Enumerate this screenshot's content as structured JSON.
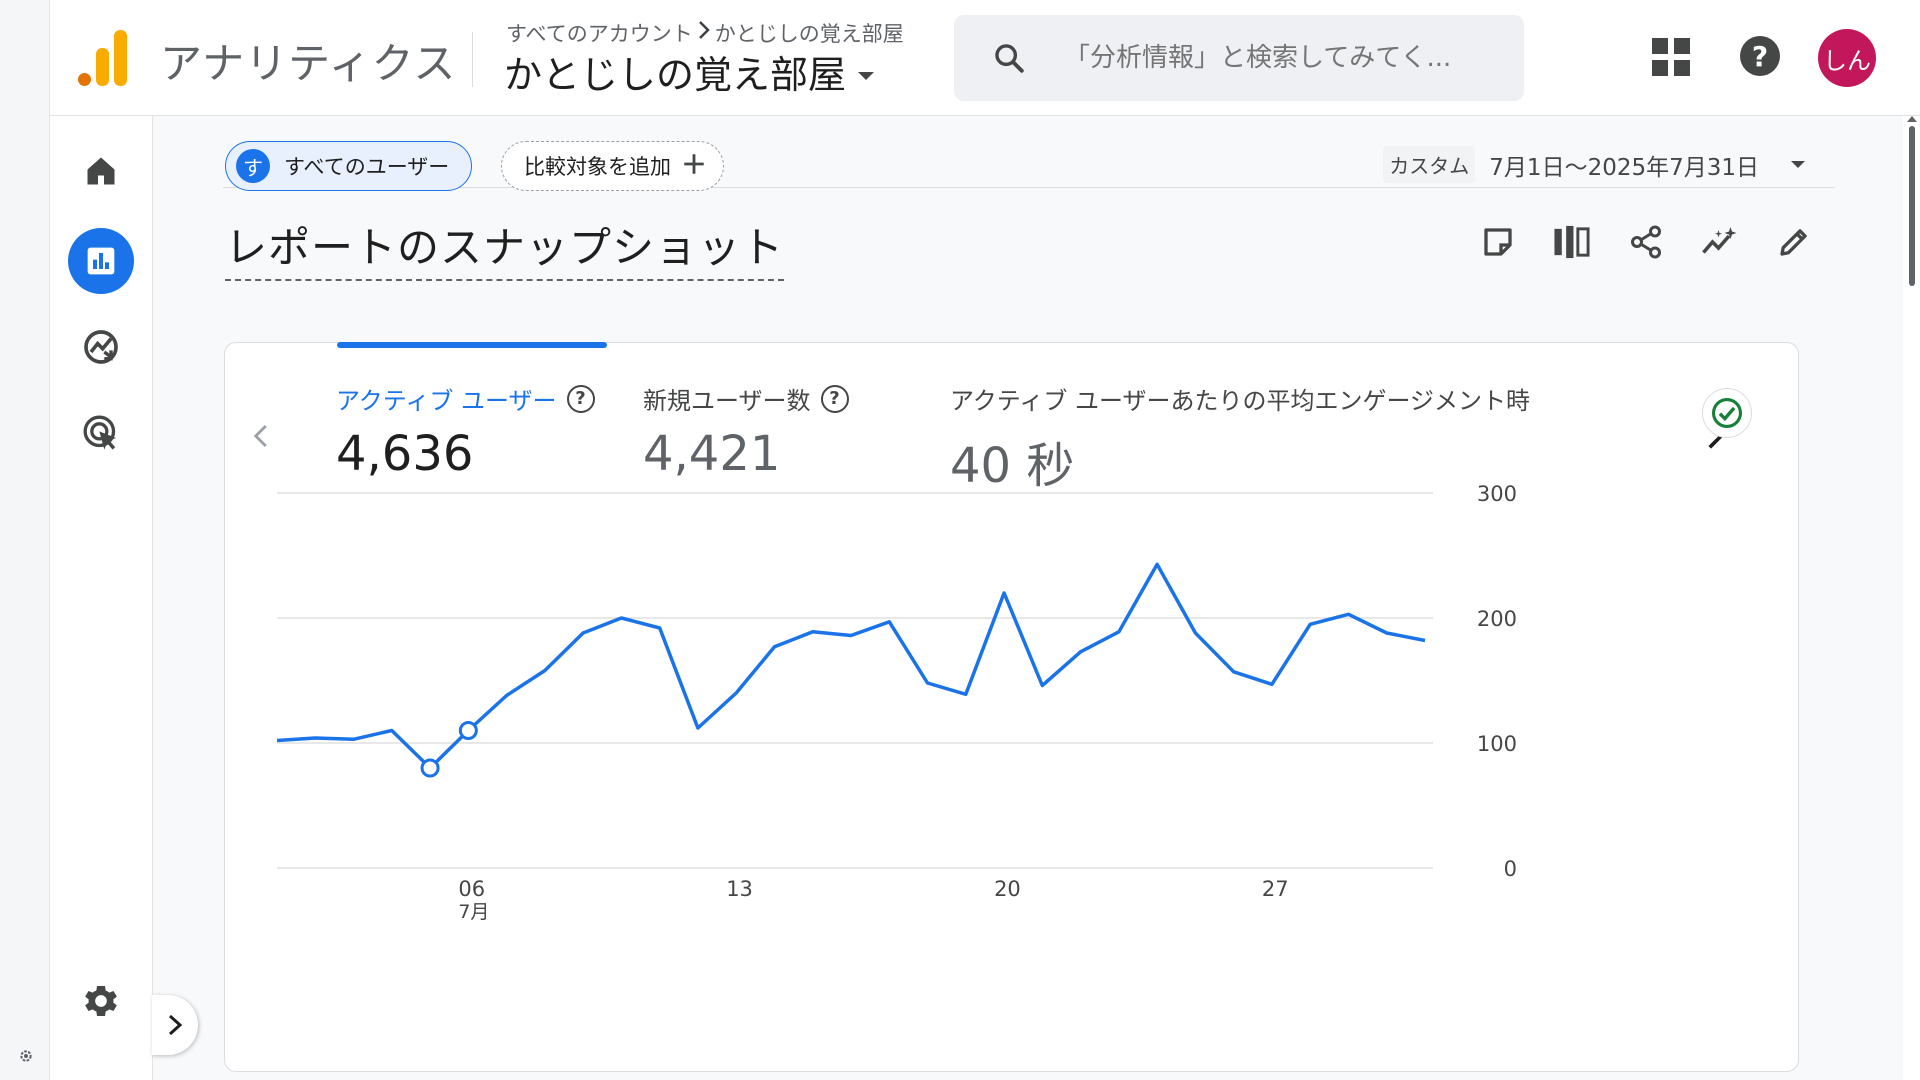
{
  "header": {
    "app_title": "アナリティクス",
    "breadcrumb": [
      "すべてのアカウント",
      "かとじしの覚え部屋"
    ],
    "property_name": "かとじしの覚え部屋",
    "search_placeholder": "「分析情報」と検索してみてく...",
    "avatar_text": "しん"
  },
  "filters": {
    "user_chip_letter": "す",
    "user_chip_label": "すべてのユーザー",
    "compare_label": "比較対象を追加",
    "date_custom": "カスタム",
    "date_range": "7月1日～2025年7月31日"
  },
  "page": {
    "title": "レポートのスナップショット"
  },
  "metrics": [
    {
      "label": "アクティブ ユーザー",
      "value": "4,636"
    },
    {
      "label": "新規ユーザー数",
      "value": "4,421"
    },
    {
      "label": "アクティブ ユーザーあたりの平均エンゲージメント時",
      "value": "40 秒"
    }
  ],
  "colors": {
    "accent": "#1a73e8",
    "avatar": "#c2185b",
    "logo_orange": "#e37400",
    "logo_yellow": "#f9ab00",
    "check": "#188038"
  },
  "icons": {
    "nav": [
      "home-icon",
      "reports-icon",
      "explore-icon",
      "advertising-icon",
      "settings-icon"
    ],
    "toolbar": [
      "note-icon",
      "compare-icon",
      "share-icon",
      "insights-icon",
      "edit-icon"
    ]
  },
  "chart_data": {
    "type": "line",
    "x": [
      1,
      2,
      3,
      4,
      5,
      6,
      7,
      8,
      9,
      10,
      11,
      12,
      13,
      14,
      15,
      16,
      17,
      18,
      19,
      20,
      21,
      22,
      23,
      24,
      25,
      26,
      27,
      28,
      29,
      30,
      31
    ],
    "x_tick_labels": [
      {
        "x": 6,
        "label": "06",
        "sublabel": "7月"
      },
      {
        "x": 13,
        "label": "13"
      },
      {
        "x": 20,
        "label": "20"
      },
      {
        "x": 27,
        "label": "27"
      }
    ],
    "series": [
      {
        "values": [
          102,
          104,
          103,
          110,
          80,
          110,
          138,
          158,
          188,
          200,
          192,
          112,
          140,
          177,
          189,
          186,
          197,
          148,
          139,
          220,
          146,
          173,
          189,
          243,
          188,
          157,
          147,
          195,
          203,
          188,
          182
        ],
        "markers": [
          5,
          6
        ]
      }
    ],
    "y_ticks": [
      0,
      100,
      200,
      300
    ],
    "ylim": [
      0,
      300
    ],
    "grid": true,
    "y_axis_position": "right"
  }
}
